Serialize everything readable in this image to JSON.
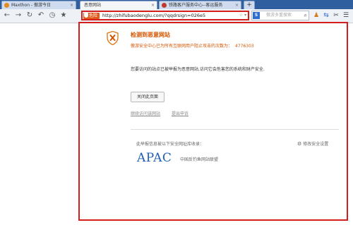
{
  "tabs": [
    {
      "label": "Maxthon - 傲游今日",
      "close": "×"
    },
    {
      "label": "恶意网站",
      "close": "×"
    },
    {
      "label": "铁路客户服务中心--客运服务",
      "close": "×"
    }
  ],
  "new_tab": "+",
  "address_bar": {
    "danger_label": "危险",
    "url": "http://zhifubaodenglu.com/?qqdrsign=026e5"
  },
  "search": {
    "placeholder": "傲游多重搜索"
  },
  "page": {
    "title": "检测到恶意网站",
    "subtitle": "傲游安全中心已为所有互联网用户阻止攻击的次数为：",
    "block_count": "4776303",
    "message": "您要访问的站点已被举报为恶意网站,访问它会危害您的系统和财产安全.",
    "close_button": "关闭此页面",
    "continue_link": "继续访问该网站",
    "report_link": "提出申诉",
    "source_text": "此举报信息被以下安全网址库收录：",
    "settings_link": "修改安全设置",
    "apac_logo": "APAC",
    "apac_name": "中国反钓鱼网站联盟"
  },
  "colors": {
    "danger": "#d31e1e",
    "accent_orange": "#d35400",
    "apac_blue": "#1d5fb0"
  }
}
